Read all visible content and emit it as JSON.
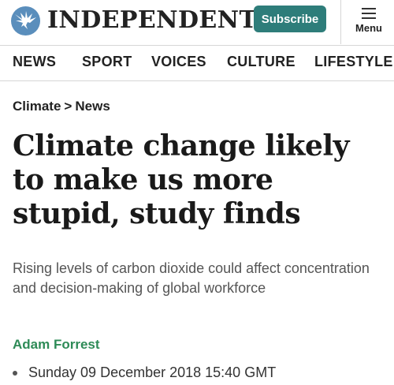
{
  "header": {
    "logo_icon": "eagle-icon",
    "logo_text": "INDEPENDENT",
    "subscribe_label": "Subscribe",
    "menu_label": "Menu",
    "menu_icon": "hamburger-icon",
    "brand_color": "#2e7d7a",
    "logo_color": "#5a8ebc"
  },
  "nav": {
    "items": [
      {
        "label": "NEWS"
      },
      {
        "label": "SPORT"
      },
      {
        "label": "VOICES"
      },
      {
        "label": "CULTURE"
      },
      {
        "label": "LIFESTYLE"
      }
    ]
  },
  "breadcrumb": {
    "section": "Climate",
    "separator": ">",
    "subsection": "News"
  },
  "article": {
    "headline": "Climate change likely to make us more stupid, study finds",
    "standfirst": "Rising levels of carbon dioxide could affect concentration and decision-making of global workforce",
    "author": "Adam Forrest",
    "author_color": "#2e8b57",
    "date": "Sunday 09 December 2018 15:40 GMT"
  }
}
